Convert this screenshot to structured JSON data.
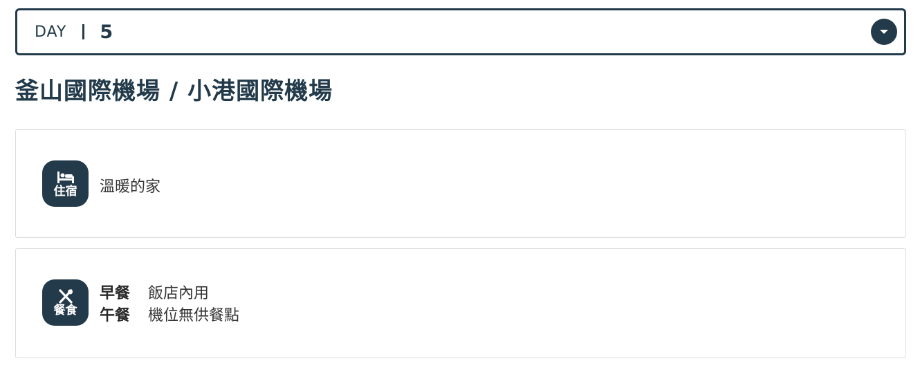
{
  "day_selector": {
    "label": "DAY",
    "number": "5",
    "dropdown_icon": "chevron-down-icon"
  },
  "route": {
    "title": "釜山國際機場 / 小港國際機場"
  },
  "lodging": {
    "badge_icon": "bed-icon",
    "badge_label": "住宿",
    "text": "溫暖的家"
  },
  "meals": {
    "badge_icon": "utensils-icon",
    "badge_label": "餐食",
    "items": [
      {
        "name": "早餐",
        "detail": "飯店內用"
      },
      {
        "name": "午餐",
        "detail": "機位無供餐點"
      }
    ]
  },
  "colors": {
    "primary": "#233a4a",
    "card_border": "#dcdcdc",
    "text": "#333333"
  }
}
